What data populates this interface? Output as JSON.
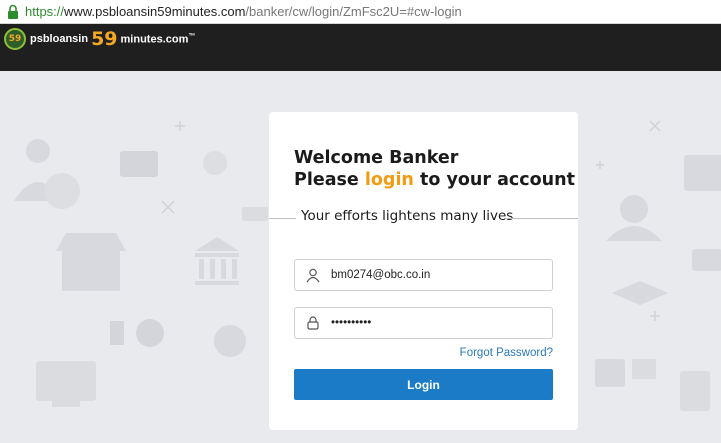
{
  "browser": {
    "url_scheme": "https://",
    "url_host": "www.psbloansin59minutes.com",
    "url_path": "/banker/cw/login/ZmFsc2U=#cw-login"
  },
  "header": {
    "logo_badge": "59",
    "logo_prefix": "psbloansin",
    "logo_number": "59",
    "logo_suffix": "minutes.com",
    "logo_tm": "™"
  },
  "card": {
    "heading_line1": "Welcome Banker",
    "heading_line2_a": "Please ",
    "heading_line2_accent": "login",
    "heading_line2_b": " to your account",
    "tagline": "Your efforts lightens many lives",
    "email_value": "bm0274@obc.co.in",
    "password_value": "••••••••••",
    "forgot_label": "Forgot Password?",
    "login_label": "Login"
  },
  "colors": {
    "accent": "#f39c12",
    "primary": "#1b7bc6",
    "header_bg": "#1f1f1f",
    "page_bg": "#e9eaed"
  }
}
